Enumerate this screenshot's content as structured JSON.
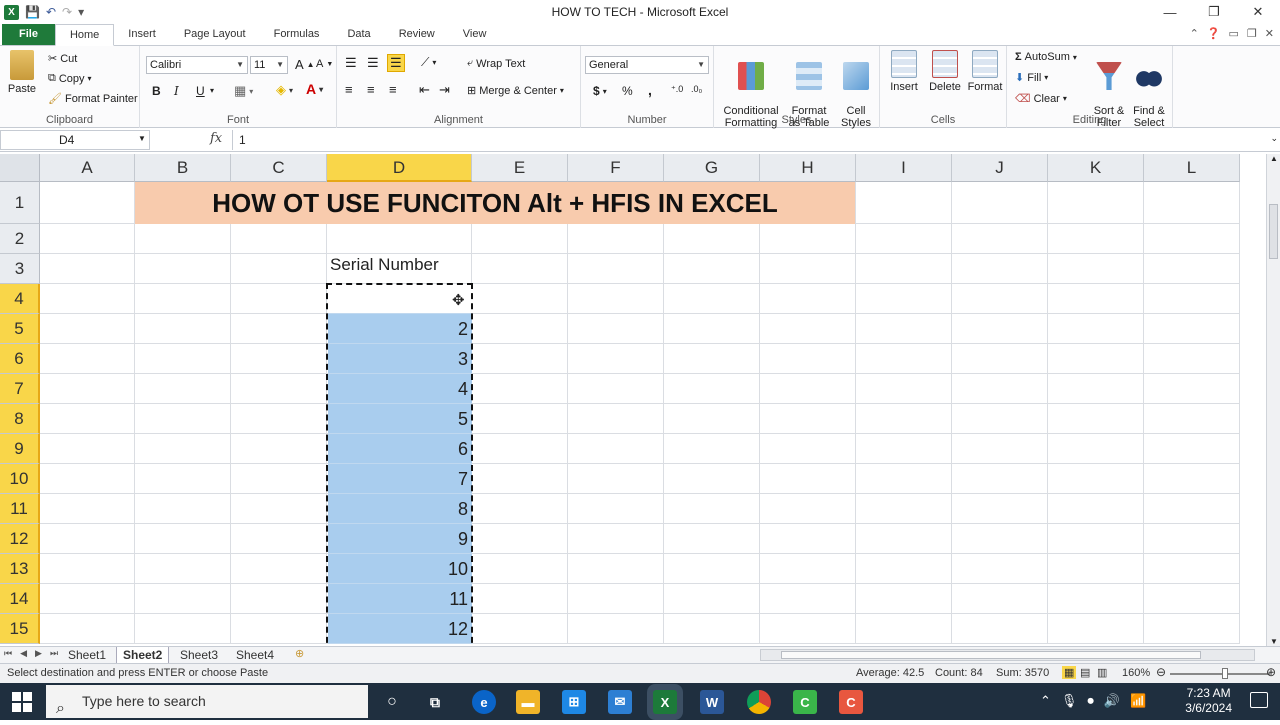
{
  "titlebar": {
    "title": "HOW TO TECH  -  Microsoft Excel",
    "minimize": "—",
    "restore": "❐",
    "close": "✕"
  },
  "tabs": [
    "File",
    "Home",
    "Insert",
    "Page Layout",
    "Formulas",
    "Data",
    "Review",
    "View"
  ],
  "ribbon": {
    "clipboard": {
      "label": "Clipboard",
      "paste": "Paste",
      "cut": "Cut",
      "copy": "Copy",
      "format_painter": "Format Painter"
    },
    "font": {
      "label": "Font",
      "font_name": "Calibri",
      "font_size": "11",
      "bold": "B",
      "italic": "I",
      "underline": "U"
    },
    "alignment": {
      "label": "Alignment",
      "wrap_text": "Wrap Text",
      "merge_center": "Merge & Center"
    },
    "number": {
      "label": "Number",
      "format": "General",
      "currency": "$",
      "percent": "%",
      "comma": ","
    },
    "styles": {
      "label": "Styles",
      "conditional": "Conditional\nFormatting",
      "format_table": "Format\nas Table",
      "cell_styles": "Cell\nStyles"
    },
    "cells": {
      "label": "Cells",
      "insert": "Insert",
      "delete": "Delete",
      "format": "Format"
    },
    "editing": {
      "label": "Editing",
      "autosum": "AutoSum",
      "fill": "Fill",
      "clear": "Clear",
      "sort_filter": "Sort &\nFilter",
      "find_select": "Find &\nSelect"
    }
  },
  "formula_bar": {
    "name_box": "D4",
    "fx": "fx",
    "value": "1"
  },
  "grid": {
    "columns": [
      "A",
      "B",
      "C",
      "D",
      "E",
      "F",
      "G",
      "H",
      "I",
      "J",
      "K",
      "L"
    ],
    "rows": [
      "1",
      "2",
      "3",
      "4",
      "5",
      "6",
      "7",
      "8",
      "9",
      "10",
      "11",
      "12",
      "13",
      "14",
      "15"
    ],
    "title": "HOW OT USE FUNCITON Alt + HFIS IN EXCEL",
    "header_label": "Serial Number",
    "serial_values": [
      "",
      "2",
      "3",
      "4",
      "5",
      "6",
      "7",
      "8",
      "9",
      "10",
      "11",
      "12"
    ]
  },
  "sheets": [
    "Sheet1",
    "Sheet2",
    "Sheet3",
    "Sheet4"
  ],
  "status": {
    "message": "Select destination and press ENTER or choose Paste",
    "average": "Average: 42.5",
    "count": "Count: 84",
    "sum": "Sum: 3570",
    "zoom": "160%"
  },
  "taskbar": {
    "search_placeholder": "Type here to search",
    "time": "7:23 AM",
    "date": "3/6/2024"
  }
}
